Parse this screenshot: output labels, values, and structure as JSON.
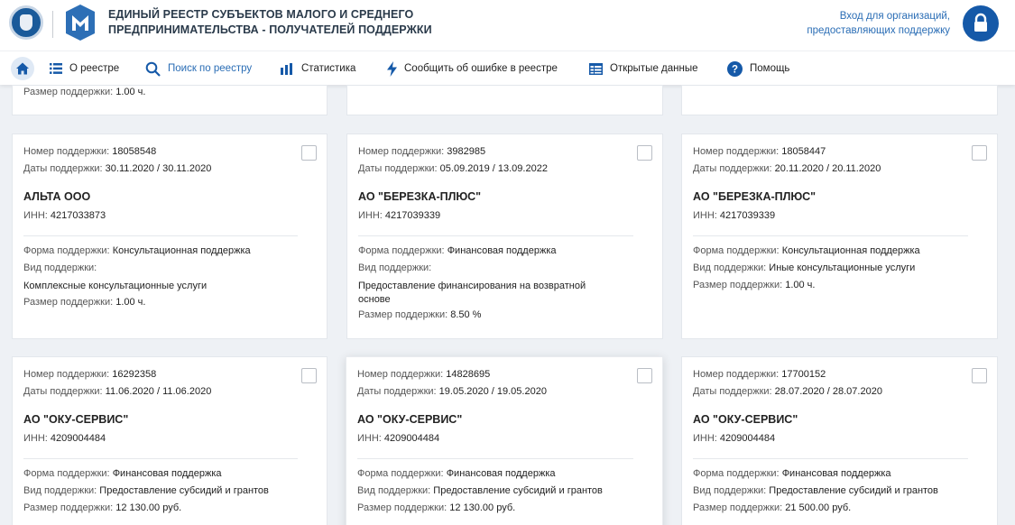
{
  "header": {
    "title_line1": "ЕДИНЫЙ РЕЕСТР СУБЪЕКТОВ МАЛОГО И СРЕДНЕГО",
    "title_line2": "ПРЕДПРИНИМАТЕЛЬСТВА - ПОЛУЧАТЕЛЕЙ ПОДДЕРЖКИ",
    "org_login_line1": "Вход для организаций,",
    "org_login_line2": "предоставляющих поддержку",
    "accent_color": "#1559a8"
  },
  "nav": {
    "items": [
      {
        "label": "О реестре",
        "icon": "list-icon"
      },
      {
        "label": "Поиск по реестру",
        "icon": "search-icon",
        "active": true
      },
      {
        "label": "Статистика",
        "icon": "bar-chart-icon"
      },
      {
        "label": "Сообщить об ошибке в реестре",
        "icon": "lightning-icon"
      },
      {
        "label": "Открытые данные",
        "icon": "table-icon"
      },
      {
        "label": "Помощь",
        "icon": "help-icon"
      }
    ]
  },
  "labels": {
    "number": "Номер поддержки:",
    "dates": "Даты поддержки:",
    "inn": "ИНН:",
    "form": "Форма поддержки:",
    "kind": "Вид поддержки:",
    "size": "Размер поддержки:"
  },
  "partial": {
    "size_value": "1.00 ч."
  },
  "cards": [
    {
      "number": "18058548",
      "dates": "30.11.2020 / 30.11.2020",
      "name": "АЛЬТА ООО",
      "inn": "4217033873",
      "form": "Консультационная поддержка",
      "kind": "Комплексные консультационные услуги",
      "size": "1.00 ч."
    },
    {
      "number": "3982985",
      "dates": "05.09.2019 / 13.09.2022",
      "name": "АО \"БЕРЕЗКА-ПЛЮС\"",
      "inn": "4217039339",
      "form": "Финансовая поддержка",
      "kind": "Предоставление финансирования на возвратной основе",
      "size": "8.50 %"
    },
    {
      "number": "18058447",
      "dates": "20.11.2020 / 20.11.2020",
      "name": "АО \"БЕРЕЗКА-ПЛЮС\"",
      "inn": "4217039339",
      "form": "Консультационная поддержка",
      "kind": "Иные консультационные услуги",
      "size": "1.00 ч."
    },
    {
      "number": "16292358",
      "dates": "11.06.2020 / 11.06.2020",
      "name": "АО \"ОКУ-СЕРВИС\"",
      "inn": "4209004484",
      "form": "Финансовая поддержка",
      "kind": "Предоставление субсидий и грантов",
      "size": "12 130.00 руб."
    },
    {
      "number": "14828695",
      "dates": "19.05.2020 / 19.05.2020",
      "name": "АО \"ОКУ-СЕРВИС\"",
      "inn": "4209004484",
      "form": "Финансовая поддержка",
      "kind": "Предоставление субсидий и грантов",
      "size": "12 130.00 руб."
    },
    {
      "number": "17700152",
      "dates": "28.07.2020 / 28.07.2020",
      "name": "АО \"ОКУ-СЕРВИС\"",
      "inn": "4209004484",
      "form": "Финансовая поддержка",
      "kind": "Предоставление субсидий и грантов",
      "size": "21 500.00 руб."
    }
  ]
}
